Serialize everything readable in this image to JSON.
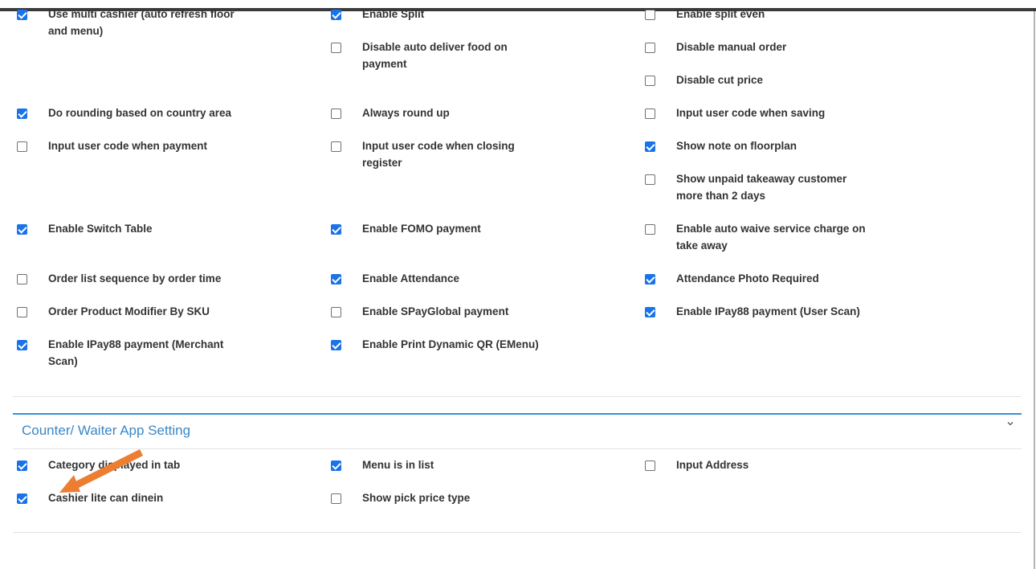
{
  "general": {
    "row1": {
      "c1": {
        "label": "Use multi cashier (auto refresh floor and menu)",
        "checked": true
      },
      "c2": {
        "label": "Enable Split",
        "checked": true
      },
      "c3": {
        "label": "Enable split even",
        "checked": false
      }
    },
    "row2": {
      "c2": {
        "label": "Disable auto deliver food on payment",
        "checked": false
      },
      "c3": {
        "label": "Disable manual order",
        "checked": false
      }
    },
    "row3": {
      "c3": {
        "label": "Disable cut price",
        "checked": false
      }
    },
    "row4": {
      "c1": {
        "label": "Do rounding based on country area",
        "checked": true
      },
      "c2": {
        "label": "Always round up",
        "checked": false
      },
      "c3": {
        "label": "Input user code when saving",
        "checked": false
      }
    },
    "row5": {
      "c1": {
        "label": "Input user code when payment",
        "checked": false
      },
      "c2": {
        "label": "Input user code when closing register",
        "checked": false
      },
      "c3": {
        "label": "Show note on floorplan",
        "checked": true
      }
    },
    "row6": {
      "c3": {
        "label": "Show unpaid takeaway customer more than 2 days",
        "checked": false
      }
    },
    "row7": {
      "c1": {
        "label": "Enable Switch Table",
        "checked": true
      },
      "c2": {
        "label": "Enable FOMO payment",
        "checked": true
      },
      "c3": {
        "label": "Enable auto waive service charge on take away",
        "checked": false
      }
    },
    "row8": {
      "c1": {
        "label": "Order list sequence by order time",
        "checked": false
      },
      "c2": {
        "label": "Enable Attendance",
        "checked": true
      },
      "c3": {
        "label": "Attendance Photo Required",
        "checked": true
      }
    },
    "row9": {
      "c1": {
        "label": "Order Product Modifier By SKU",
        "checked": false
      },
      "c2": {
        "label": "Enable SPayGlobal payment",
        "checked": false
      },
      "c3": {
        "label": "Enable IPay88 payment (User Scan)",
        "checked": true
      }
    },
    "row10": {
      "c1": {
        "label": "Enable IPay88 payment (Merchant Scan)",
        "checked": true
      },
      "c2": {
        "label": "Enable Print Dynamic QR (EMenu)",
        "checked": true
      }
    }
  },
  "counter_section": {
    "title": "Counter/ Waiter App Setting",
    "row1": {
      "c1": {
        "label": "Category displayed in tab",
        "checked": true
      },
      "c2": {
        "label": "Menu is in list",
        "checked": true
      },
      "c3": {
        "label": "Input Address",
        "checked": false
      }
    },
    "row2": {
      "c1": {
        "label": "Cashier lite can dinein",
        "checked": true
      },
      "c2": {
        "label": "Show pick price type",
        "checked": false
      }
    }
  },
  "colors": {
    "accent": "#3a87c6",
    "checkbox_checked": "#1a73e8",
    "annotation_arrow": "#ed7d31"
  },
  "icons": {
    "collapse": "chevron-down-icon",
    "annotation": "arrow-annotation"
  }
}
